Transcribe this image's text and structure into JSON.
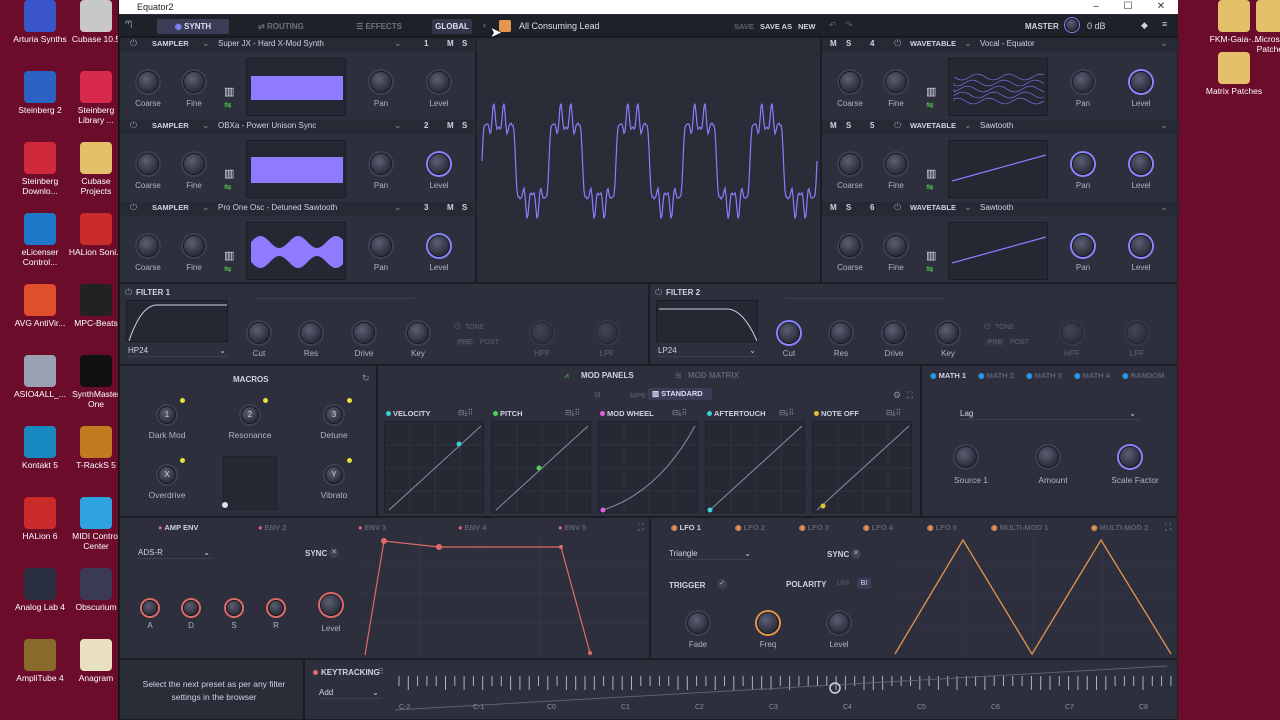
{
  "desktop_left": [
    {
      "label": "Arturia Synths",
      "color": "#3a56c8"
    },
    {
      "label": "Steinberg 2",
      "color": "#2b62c4"
    },
    {
      "label": "Steinberg Downlo...",
      "color": "#d02a3a"
    },
    {
      "label": "eLicenser Control...",
      "color": "#1d78c9"
    },
    {
      "label": "AVG AntiVir...",
      "color": "#e14f2a"
    },
    {
      "label": "ASIO4ALL_...",
      "color": "#9aa1b0"
    },
    {
      "label": "Kontakt 5",
      "color": "#1789c2"
    },
    {
      "label": "HALion 6",
      "color": "#c92a2a"
    },
    {
      "label": "Analog Lab 4",
      "color": "#2b3040"
    },
    {
      "label": "AmpliTube 4",
      "color": "#8a6a2a"
    }
  ],
  "desktop_right": [
    {
      "label": "Cubase 10.5",
      "color": "#c8c8c8"
    },
    {
      "label": "Steinberg Library ...",
      "color": "#d82b4b"
    },
    {
      "label": "Cubase Projects",
      "color": "#e5c06a"
    },
    {
      "label": "HALion Soni...",
      "color": "#c92a2a"
    },
    {
      "label": "MPC-Beats",
      "color": "#222"
    },
    {
      "label": "SynthMaster One",
      "color": "#111"
    },
    {
      "label": "T-RackS 5",
      "color": "#c07a20"
    },
    {
      "label": "MIDI Control Center",
      "color": "#2ea3e0"
    },
    {
      "label": "Obscurium",
      "color": "#3a3a52"
    },
    {
      "label": "Anagram",
      "color": "#e8e0c0"
    }
  ],
  "desktop_far_right": [
    {
      "label": "FKM-Gaia-...",
      "color": "#e5c06a"
    },
    {
      "label": "Microsoft Patches",
      "color": "#e5c06a"
    },
    {
      "label": "Matrix Patches",
      "color": "#e5c06a"
    }
  ],
  "title": "Equator2",
  "topbar": {
    "tabs": [
      "SYNTH",
      "ROUTING",
      "EFFECTS",
      "GLOBAL"
    ],
    "preset_name": "All Consuming Lead",
    "save": "SAVE",
    "save_as": "SAVE AS",
    "new": "NEW",
    "master_label": "MASTER",
    "master_value": "0 dB"
  },
  "left_oscs": [
    {
      "type": "SAMPLER",
      "name": "Super JX - Hard X-Mod Synth",
      "num": "1",
      "m": "M",
      "s": "S",
      "knobs": [
        "Coarse",
        "Fine",
        "Pan",
        "Level"
      ]
    },
    {
      "type": "SAMPLER",
      "name": "OBXa - Power Unison Sync",
      "num": "2",
      "m": "M",
      "s": "S",
      "knobs": [
        "Coarse",
        "Fine",
        "Pan",
        "Level"
      ]
    },
    {
      "type": "SAMPLER",
      "name": "Pro One Osc - Detuned Sawtooth",
      "num": "3",
      "m": "M",
      "s": "S",
      "knobs": [
        "Coarse",
        "Fine",
        "Pan",
        "Level"
      ]
    }
  ],
  "right_oscs": [
    {
      "type": "WAVETABLE",
      "name": "Vocal - Equator",
      "num": "4",
      "m": "M",
      "s": "S",
      "knobs": [
        "Coarse",
        "Fine",
        "Pan",
        "Level"
      ]
    },
    {
      "type": "WAVETABLE",
      "name": "Sawtooth",
      "num": "5",
      "m": "M",
      "s": "S",
      "knobs": [
        "Coarse",
        "Fine",
        "Pan",
        "Level"
      ]
    },
    {
      "type": "WAVETABLE",
      "name": "Sawtooth",
      "num": "6",
      "m": "M",
      "s": "S",
      "knobs": [
        "Coarse",
        "Fine",
        "Pan",
        "Level"
      ]
    }
  ],
  "filter1": {
    "title": "FILTER 1",
    "type": "HP24",
    "knobs": [
      "Cut",
      "Res",
      "Drive",
      "Key"
    ],
    "tone": "TONE",
    "pre": "PRE",
    "post": "POST",
    "hpf": "HPF",
    "lpf": "LPF"
  },
  "filter2": {
    "title": "FILTER 2",
    "type": "LP24",
    "knobs": [
      "Cut",
      "Res",
      "Drive",
      "Key"
    ],
    "tone": "TONE",
    "pre": "PRE",
    "post": "POST",
    "hpf": "HPF",
    "lpf": "LPF"
  },
  "macros": {
    "title": "MACROS",
    "items": [
      {
        "n": "1",
        "label": "Dark Mod"
      },
      {
        "n": "2",
        "label": "Resonance"
      },
      {
        "n": "3",
        "label": "Detune"
      },
      {
        "n": "X",
        "label": "Overdrive"
      },
      {
        "n": "Y",
        "label": "Vibrato"
      }
    ]
  },
  "mod_panels": {
    "tab1": "MOD PANELS",
    "tab2": "MOD MATRIX",
    "mpe": "MPE",
    "standard": "STANDARD",
    "curves": [
      {
        "label": "VELOCITY",
        "color": "#3ad3d3"
      },
      {
        "label": "PITCH",
        "color": "#4fd24f"
      },
      {
        "label": "MOD WHEEL",
        "color": "#e060e0"
      },
      {
        "label": "AFTERTOUCH",
        "color": "#3ad3d3"
      },
      {
        "label": "NOTE OFF",
        "color": "#e5c030"
      }
    ]
  },
  "math": {
    "tabs": [
      "MATH 1",
      "MATH 2",
      "MATH 3",
      "MATH 4",
      "RANDOM"
    ],
    "mode": "Lag",
    "knobs": [
      "Source 1",
      "Amount",
      "Scale Factor"
    ]
  },
  "env": {
    "tabs": [
      "AMP ENV",
      "ENV 2",
      "ENV 3",
      "ENV 4",
      "ENV 5"
    ],
    "mode": "ADS-R",
    "sync": "SYNC",
    "knobs": [
      "A",
      "D",
      "S",
      "R"
    ],
    "level": "Level"
  },
  "lfo": {
    "tabs": [
      "LFO 1",
      "LFO 2",
      "LFO 3",
      "LFO 4",
      "LFO 5",
      "MULTI-MOD 1",
      "MULTI-MOD 2"
    ],
    "shape": "Triangle",
    "sync": "SYNC",
    "trigger": "TRIGGER",
    "polarity": "POLARITY",
    "uni": "UNI",
    "bi": "BI",
    "knobs": [
      "Fade",
      "Freq",
      "Level"
    ]
  },
  "hint_text": "Select the next preset as per any filter settings in the browser",
  "keytracking": {
    "label": "KEYTRACKING",
    "mode": "Add",
    "notes": [
      "C-2",
      "C-1",
      "C0",
      "C1",
      "C2",
      "C3",
      "C4",
      "C5",
      "C6",
      "C7",
      "C8"
    ]
  },
  "colors": {
    "accent": "#8a86ff",
    "env": "#e06a6a",
    "lfo": "#e5954e"
  }
}
